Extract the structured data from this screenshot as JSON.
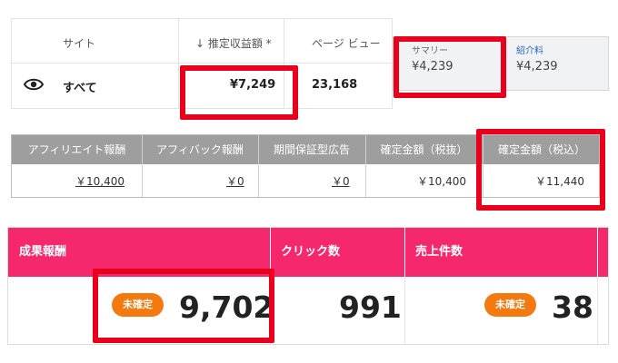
{
  "site_table": {
    "headers": {
      "site": "サイト",
      "est_revenue": "↓ 推定収益額 *",
      "page_views": "ページ ビュー"
    },
    "row": {
      "site": "すべて",
      "est_revenue": "¥7,249",
      "page_views": "23,168"
    }
  },
  "summary": {
    "summary_label": "サマリー",
    "summary_value": "¥4,239",
    "referral_label": "紹介料",
    "referral_value": "¥4,239"
  },
  "reward_table": {
    "headers": [
      "アフィリエイト報酬",
      "アフィバック報酬",
      "期間保証型広告",
      "確定金額（税抜）",
      "確定金額（税込）"
    ],
    "values": [
      "￥10,400",
      "￥0",
      "￥0",
      "￥10,400",
      "￥11,440"
    ]
  },
  "stats": {
    "headers": [
      "成果報酬",
      "クリック数",
      "売上件数"
    ],
    "reward": {
      "badge": "未確定",
      "value": "9,702"
    },
    "clicks": {
      "value": "991"
    },
    "sales": {
      "badge": "未確定",
      "value": "38"
    }
  },
  "colors": {
    "highlight": "#e8001c",
    "pink_header": "#f5286e",
    "badge_orange": "#f47a10",
    "gray_header": "#9e9e9e"
  }
}
